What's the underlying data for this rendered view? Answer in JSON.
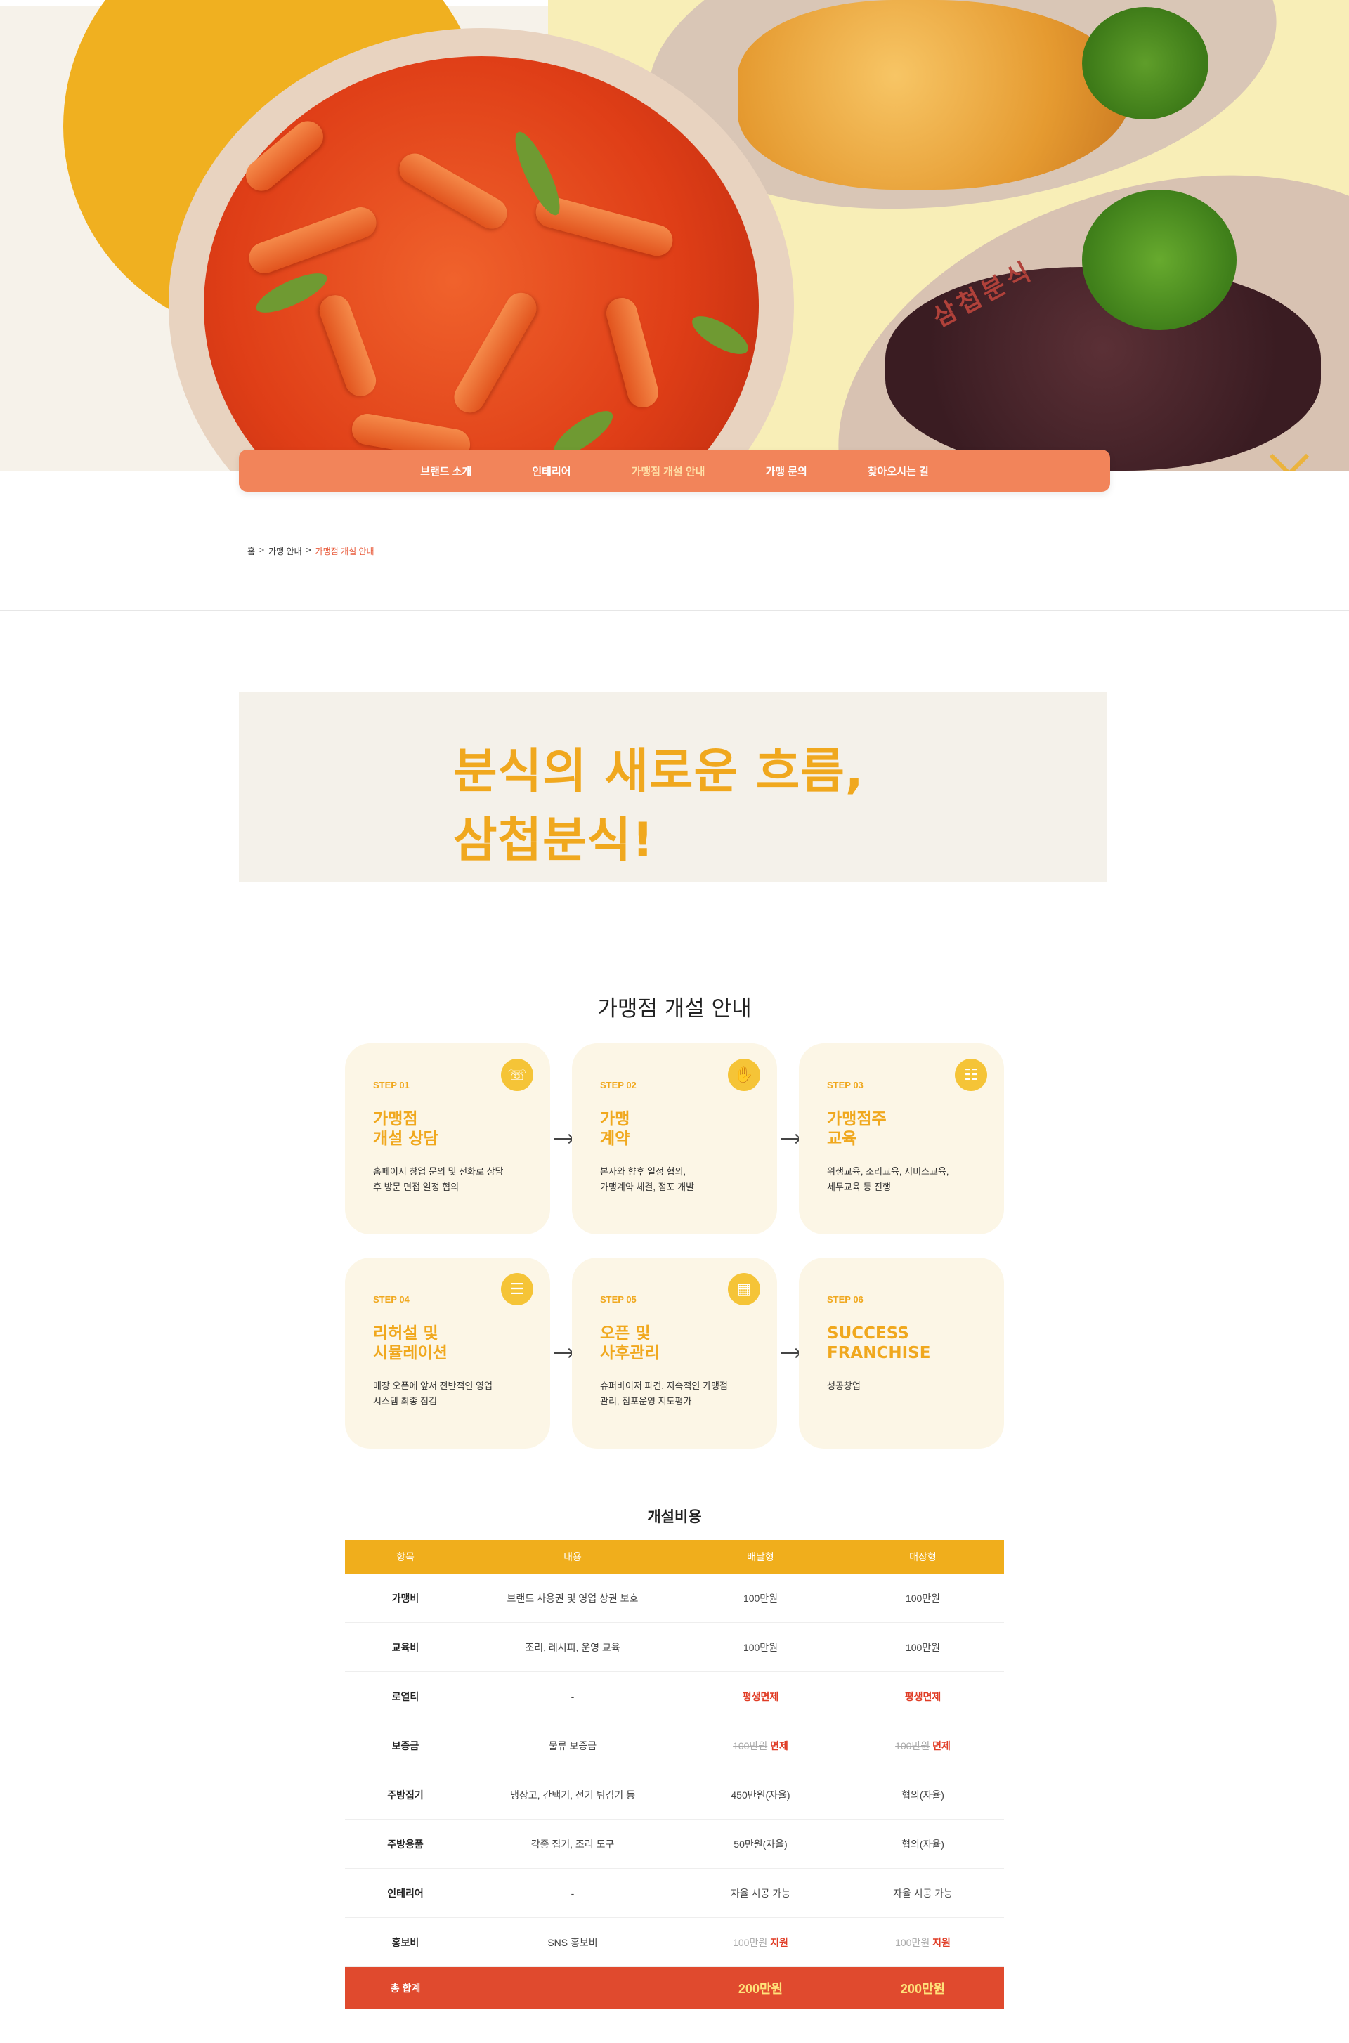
{
  "hero": {
    "plate_text": "삼첩분식"
  },
  "nav": {
    "items": [
      "브랜드 소개",
      "인테리어",
      "가맹점 개설 안내",
      "가맹 문의",
      "찾아오시는 길"
    ],
    "active_index": 2
  },
  "breadcrumb": {
    "home": "홈",
    "sep1": ">",
    "parent": "가맹 안내",
    "sep2": ">",
    "current": "가맹점 개설 안내"
  },
  "slogan": {
    "line1": "분식의 새로운 흐름,",
    "line2": "삼첩분식!"
  },
  "section_title": "가맹점 개설 안내",
  "steps": [
    {
      "num": "STEP 01",
      "title1": "가맹점",
      "title2": "개설 상담",
      "desc1": "홈페이지 창업 문의 및 전화로 상담",
      "desc2": "후 방문 면접 일정 협의",
      "icon": "headset-icon"
    },
    {
      "num": "STEP 02",
      "title1": "가맹",
      "title2": "계약",
      "desc1": "본사와 향후 일정 협의,",
      "desc2": "가맹계약 체결, 점포 개발",
      "icon": "handshake-icon"
    },
    {
      "num": "STEP 03",
      "title1": "가맹점주",
      "title2": "교육",
      "desc1": "위생교육, 조리교육, 서비스교육,",
      "desc2": "세무교육 등 진행",
      "icon": "presentation-icon"
    },
    {
      "num": "STEP 04",
      "title1": "리허설 및",
      "title2": "시뮬레이션",
      "desc1": "매장 오픈에 앞서 전반적인 영업",
      "desc2": "시스템 최종 점검",
      "icon": "checklist-icon"
    },
    {
      "num": "STEP 05",
      "title1": "오픈 및",
      "title2": "사후관리",
      "desc1": "슈퍼바이저 파견, 지속적인 가맹점",
      "desc2": "관리, 점포운영 지도평가",
      "icon": "calendar-icon"
    },
    {
      "num": "STEP 06",
      "title1": "SUCCESS",
      "title2": "FRANCHISE",
      "desc1": "성공창업",
      "desc2": "",
      "icon": ""
    }
  ],
  "cost": {
    "title": "개설비용",
    "headers": [
      "항목",
      "내용",
      "배달형",
      "매장형"
    ],
    "rows": [
      {
        "item": "가맹비",
        "content": "브랜드 사용권 및 영업 상권 보호",
        "delivery": "100만원",
        "store": "100만원"
      },
      {
        "item": "교육비",
        "content": "조리, 레시피, 운영 교육",
        "delivery": "100만원",
        "store": "100만원"
      },
      {
        "item": "로열티",
        "content": "-",
        "delivery": "평생면제",
        "store": "평생면제"
      },
      {
        "item": "보증금",
        "content": "물류 보증금",
        "delivery_strike": "100만원",
        "delivery_note": "면제",
        "store_strike": "100만원",
        "store_note": "면제"
      },
      {
        "item": "주방집기",
        "content": "냉장고, 간택기, 전기 튀김기 등",
        "delivery": "450만원(자율)",
        "store": "협의(자율)"
      },
      {
        "item": "주방용품",
        "content": "각종 집기, 조리 도구",
        "delivery": "50만원(자율)",
        "store": "협의(자율)"
      },
      {
        "item": "인테리어",
        "content": "-",
        "delivery": "자율 시공 가능",
        "store": "자율 시공 가능"
      },
      {
        "item": "홍보비",
        "content": "SNS 홍보비",
        "delivery_strike": "100만원",
        "delivery_note": "지원",
        "store_strike": "100만원",
        "store_note": "지원"
      }
    ],
    "total": {
      "label": "총 합계",
      "delivery": "200만원",
      "store": "200만원"
    }
  },
  "colors": {
    "accent_yellow": "#f0a81e",
    "nav_orange": "#f2845a",
    "total_red": "#e04a2e",
    "table_head": "#f0ae1c"
  }
}
